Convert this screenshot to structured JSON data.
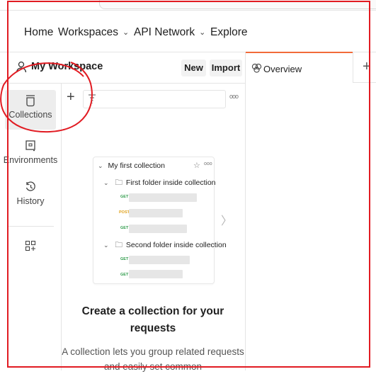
{
  "nav": {
    "items": [
      {
        "label": "Home",
        "chevron": false
      },
      {
        "label": "Workspaces",
        "chevron": true
      },
      {
        "label": "API Network",
        "chevron": true
      },
      {
        "label": "Explore",
        "chevron": false
      }
    ]
  },
  "workspace": {
    "title": "My Workspace",
    "new_label": "New",
    "import_label": "Import"
  },
  "rail": {
    "items": [
      {
        "label": "Collections",
        "icon": "collections-icon"
      },
      {
        "label": "Environments",
        "icon": "environments-icon"
      },
      {
        "label": "History",
        "icon": "history-icon"
      },
      {
        "label": "",
        "icon": "add-apps-icon"
      }
    ]
  },
  "panel": {
    "add_symbol": "+",
    "more_symbol": "ooo"
  },
  "preview": {
    "collection_label": "My first collection",
    "folder1_label": "First folder inside collection",
    "folder2_label": "Second folder inside collection",
    "methods": [
      "GET",
      "POST",
      "GET",
      "GET",
      "GET"
    ]
  },
  "empty_state": {
    "title": "Create a collection for your requests",
    "description": "A collection lets you group related requests and easily set common"
  },
  "tabs": {
    "overview_label": "Overview",
    "add_symbol": "+"
  },
  "colors": {
    "accent_tab": "#f26b3a",
    "annotation_red": "#e11b22",
    "get_method": "#2e9b4a",
    "post_method": "#e0a21c"
  }
}
